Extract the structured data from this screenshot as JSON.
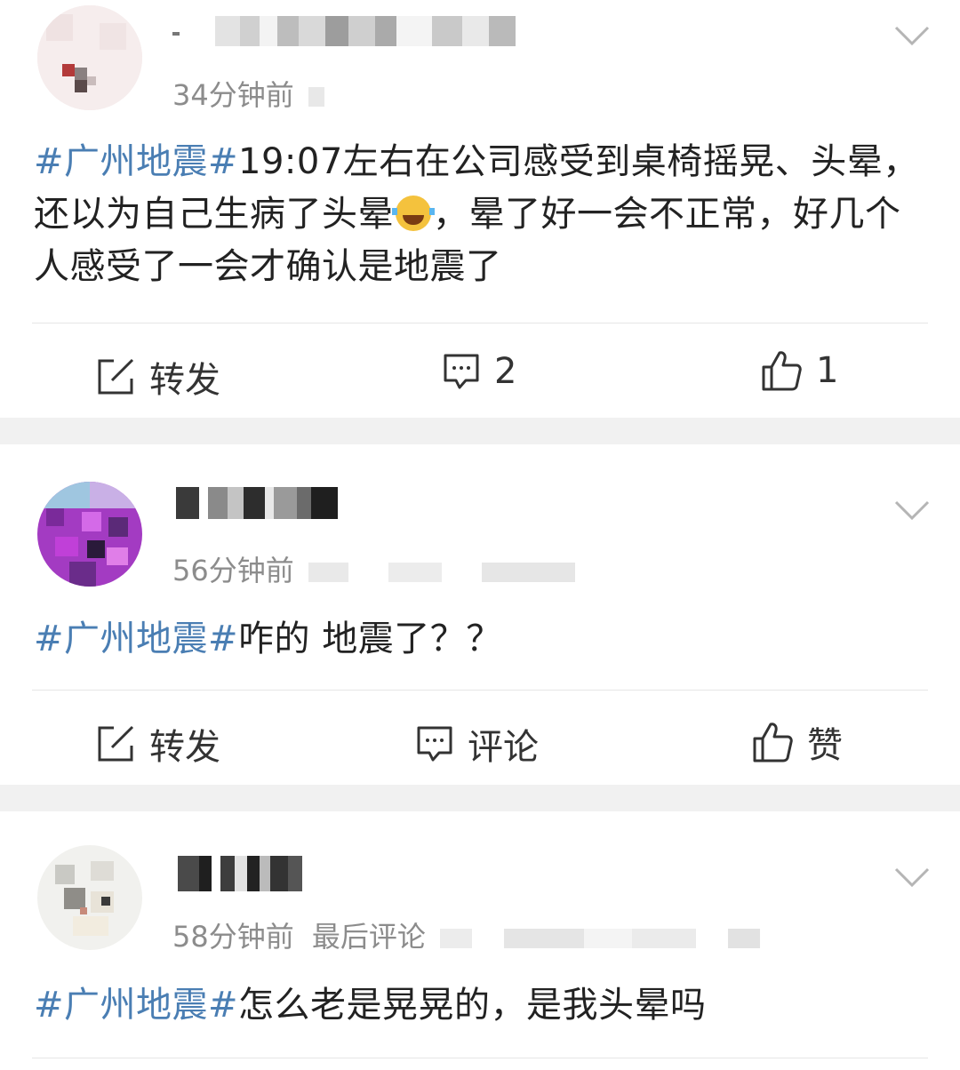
{
  "posts": [
    {
      "time": "34分钟前",
      "content": {
        "hashtag": "#广州地震#",
        "text_before_emoji": "19:07左右在公司感受到桌椅摇晃、头晕，还以为自己生病了头晕",
        "emoji": "laughing-crying-emoji",
        "text_after_emoji": "，晕了好一会不正常，好几个人感受了一会才确认是地震了"
      },
      "actions": {
        "repost": "转发",
        "comment": "2",
        "like": "1"
      }
    },
    {
      "time": "56分钟前",
      "content": {
        "hashtag": "#广州地震#",
        "text": "咋的 地震了？？"
      },
      "actions": {
        "repost": "转发",
        "comment": "评论",
        "like": "赞"
      }
    },
    {
      "time": "58分钟前",
      "extra": "最后评论",
      "content": {
        "hashtag": "#广州地震#",
        "text": "怎么老是晃晃的，是我头晕吗"
      }
    }
  ],
  "colors": {
    "hashtag": "#4a7eb3",
    "separator": "#f1f1f1",
    "meta_text": "#8c8c8c"
  }
}
